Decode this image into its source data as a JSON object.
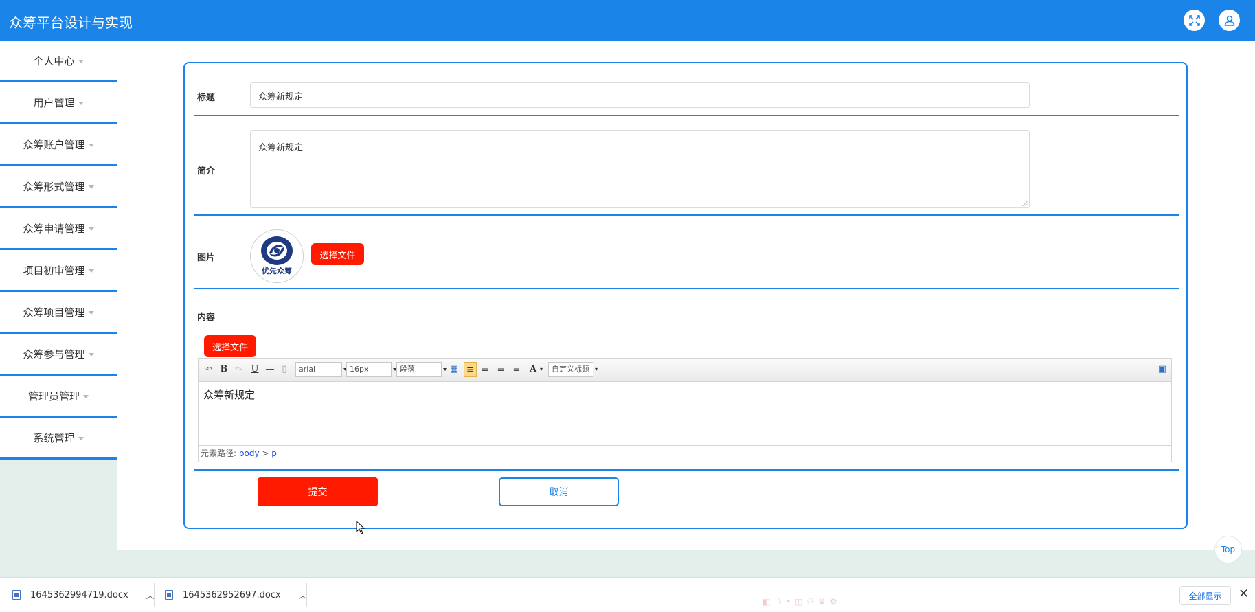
{
  "header": {
    "title": "众筹平台设计与实现",
    "fullscreen_icon": "expand-icon",
    "user_icon": "user-icon"
  },
  "sidebar": {
    "items": [
      {
        "label": "个人中心"
      },
      {
        "label": "用户管理"
      },
      {
        "label": "众筹账户管理"
      },
      {
        "label": "众筹形式管理"
      },
      {
        "label": "众筹申请管理"
      },
      {
        "label": "项目初审管理"
      },
      {
        "label": "众筹项目管理"
      },
      {
        "label": "众筹参与管理"
      },
      {
        "label": "管理员管理"
      },
      {
        "label": "系统管理"
      }
    ]
  },
  "form": {
    "title_label": "标题",
    "title_value": "众筹新规定",
    "summary_label": "简介",
    "summary_value": "众筹新规定",
    "image_label": "图片",
    "image_logo_text": "优先众筹",
    "choose_file": "选择文件",
    "content_label": "内容",
    "content_choose_file": "选择文件",
    "submit": "提交",
    "cancel": "取消"
  },
  "editor": {
    "font_family": "arial",
    "font_size": "16px",
    "paragraph": "段落",
    "custom_title": "自定义标题",
    "body_text": "众筹新规定",
    "path_label": "元素路径:",
    "path_body": "body",
    "path_sep": ">",
    "path_p": "p"
  },
  "top_button": "Top",
  "downloads": {
    "items": [
      {
        "name": "1645362994719.docx"
      },
      {
        "name": "1645362952697.docx"
      }
    ],
    "show_all": "全部显示"
  },
  "colors": {
    "primary": "#1a84e8",
    "danger": "#ff1a00"
  }
}
